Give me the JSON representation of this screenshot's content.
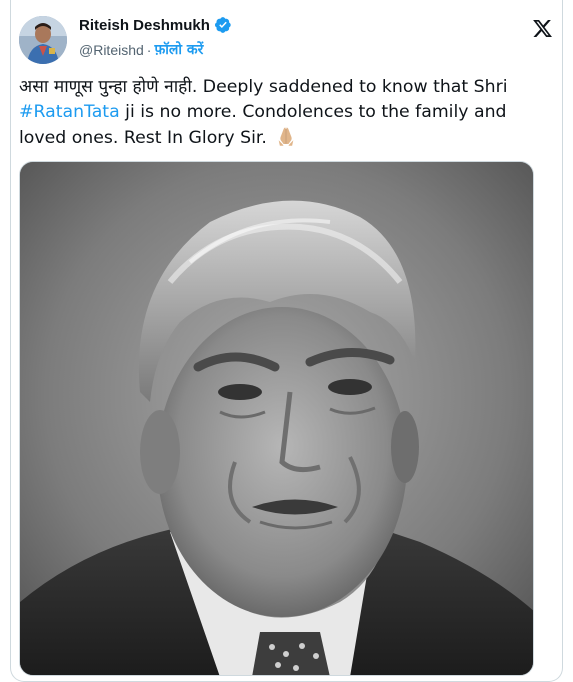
{
  "tweet": {
    "author": {
      "display_name": "Riteish Deshmukh",
      "handle": "@Riteishd",
      "separator": "·",
      "follow_label": "फ़ॉलो करें",
      "verified": true,
      "verified_color": "#1d9bf0"
    },
    "text": {
      "part1": "असा माणूस पुन्हा होणे नाही. Deeply saddened to know that Shri ",
      "hashtag": "#RatanTata",
      "part2": " ji is no more. Condolences to the family and loved ones. Rest In Glory Sir.",
      "emoji": "folded-hands-emoji"
    },
    "media": {
      "type": "photo",
      "style": "black-and-white portrait"
    },
    "colors": {
      "link": "#1d9bf0",
      "text": "#0f1419",
      "muted": "#536471",
      "border": "#cfd9de"
    }
  }
}
